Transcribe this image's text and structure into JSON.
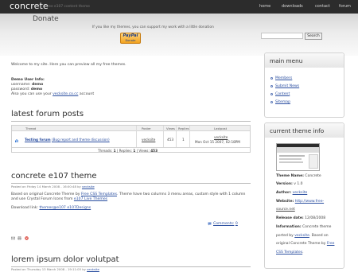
{
  "brand": {
    "logo": "concrete",
    "tagline": "free e107 content theme"
  },
  "nav": [
    "home",
    "downloads",
    "contact",
    "forum"
  ],
  "header": {
    "title": "Donate",
    "subtitle": "If you like my themes, you can support my work with a little donation",
    "paypal_brand": "PayPal",
    "paypal_action": "Donate",
    "search_placeholder": "",
    "search_button": "Search"
  },
  "welcome": {
    "text": "Welcome to my site. Here you can preview all my free themes.",
    "demo_heading": "Demo User Info:",
    "username_label": "username:",
    "username_value": "demo",
    "password_label": "password:",
    "password_value": "demo",
    "alt_prefix": "Also you can use your",
    "alt_link": "vecksite.co.cc",
    "alt_suffix": "account"
  },
  "forum": {
    "heading": "latest forum posts",
    "columns": [
      "Thread",
      "Poster",
      "Views",
      "Replies",
      "Lastpost"
    ],
    "thread_title": "Testing forum",
    "thread_sub": "(Bug report and theme discussion)",
    "poster": "vecksite",
    "views": "453",
    "replies": "1",
    "lastpost_user": "vecksite",
    "lastpost_date": "Mon Oct 15 2007, 02:18PM",
    "footer_threads_label": "Threads:",
    "footer_threads": "1",
    "footer_replies_label": "Replies:",
    "footer_replies": "1",
    "footer_views_label": "Views:",
    "footer_views": "453"
  },
  "post1": {
    "title": "concrete e107 theme",
    "meta_prefix": "Posted on Friday 14 March 2008 - 16:00:48 by",
    "meta_author": "vecksite",
    "body1_a": "Based on original Concrete Theme by",
    "body1_link": "Free CSS Templates",
    "body1_b": ". Theme have two columns 3 menu areas, custom style with 1 column",
    "body2_a": "and use Crystal Forum Icons from",
    "body2_link": "e107 Live Themes",
    "download_label": "Download link:",
    "download_link": "themes@e107 e107Designs",
    "comments_label": "Comments:",
    "comments_count": "0"
  },
  "post2": {
    "title": "lorem ipsum dolor volutpat",
    "meta_prefix": "Posted on Thursday 13 March 2008 - 19:11:05 by",
    "meta_author": "vecksite"
  },
  "sidebar": {
    "main_menu_title": "main menu",
    "menu_items": [
      "Members",
      "Submit News",
      "Content",
      "Sitemap"
    ],
    "theme_info_title": "current theme info",
    "theme_name_label": "Theme Name:",
    "theme_name": "Concrete",
    "version_label": "Version:",
    "version": "v 1.0",
    "author_label": "Author:",
    "author": "vecksite",
    "website_label": "Website:",
    "website_line1": "http://www.free-",
    "website_line2": "source.net",
    "release_label": "Release date:",
    "release": "12/08/2008",
    "info_label": "Information:",
    "info_a": "Concrete theme",
    "info_b_prefix": "ported by",
    "info_b_link": "vecksite",
    "info_b_suffix": ". Based on",
    "info_c_prefix": "original Concrete Theme by",
    "info_c_link": "Free",
    "info_d_link": "CSS Templates",
    "info_d_suffix": "."
  },
  "colors": {
    "topbar": "#2c2c2c",
    "link": "#2a4ea0",
    "heading": "#2d2d2d"
  }
}
